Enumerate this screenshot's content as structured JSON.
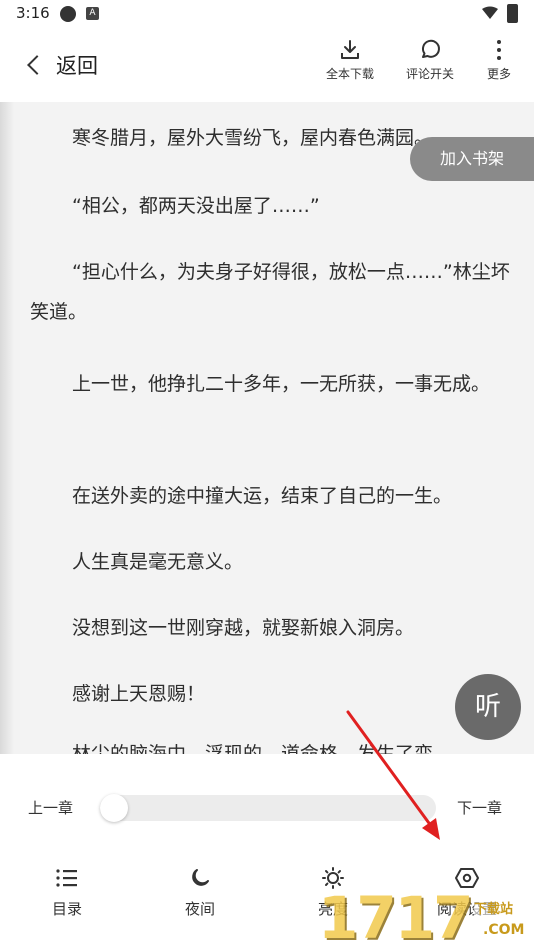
{
  "status_bar": {
    "time": "3:16",
    "notif_icon_letter": "A"
  },
  "top_bar": {
    "back_label": "返回",
    "download_label": "全本下载",
    "comment_label": "评论开关",
    "more_label": "更多"
  },
  "reader": {
    "paragraphs": [
      "寒冬腊月，屋外大雪纷飞，屋内春色满园。",
      "“相公，都两天没出屋了……”",
      "“担心什么，为夫身子好得很，放松一点……”林尘坏笑道。",
      "上一世，他挣扎二十多年，一无所获，一事无成。",
      "在送外卖的途中撞大运，结束了自己的一生。",
      "人生真是毫无意义。",
      "没想到这一世刚穿越，就娶新娘入洞房。",
      "感谢上天恩赐！",
      "林尘的脑海中，浮现的，道命格，发生了变"
    ],
    "add_shelf_label": "加入书架",
    "listen_label": "听"
  },
  "bottom_panel": {
    "prev_chapter": "上一章",
    "next_chapter": "下一章",
    "progress": 0.0,
    "nav": {
      "toc": "目录",
      "night": "夜间",
      "brightness": "亮度",
      "settings": "阅读设置"
    }
  },
  "watermark": {
    "big": "1717",
    "line1": "下载站",
    "line2": ".COM"
  },
  "colors": {
    "panel_bg": "#ffffff",
    "page_bg": "#f3f3f3",
    "shelf_btn": "#8a8a8a",
    "listen_btn": "#6a6a6a",
    "arrow": "#e02020"
  }
}
